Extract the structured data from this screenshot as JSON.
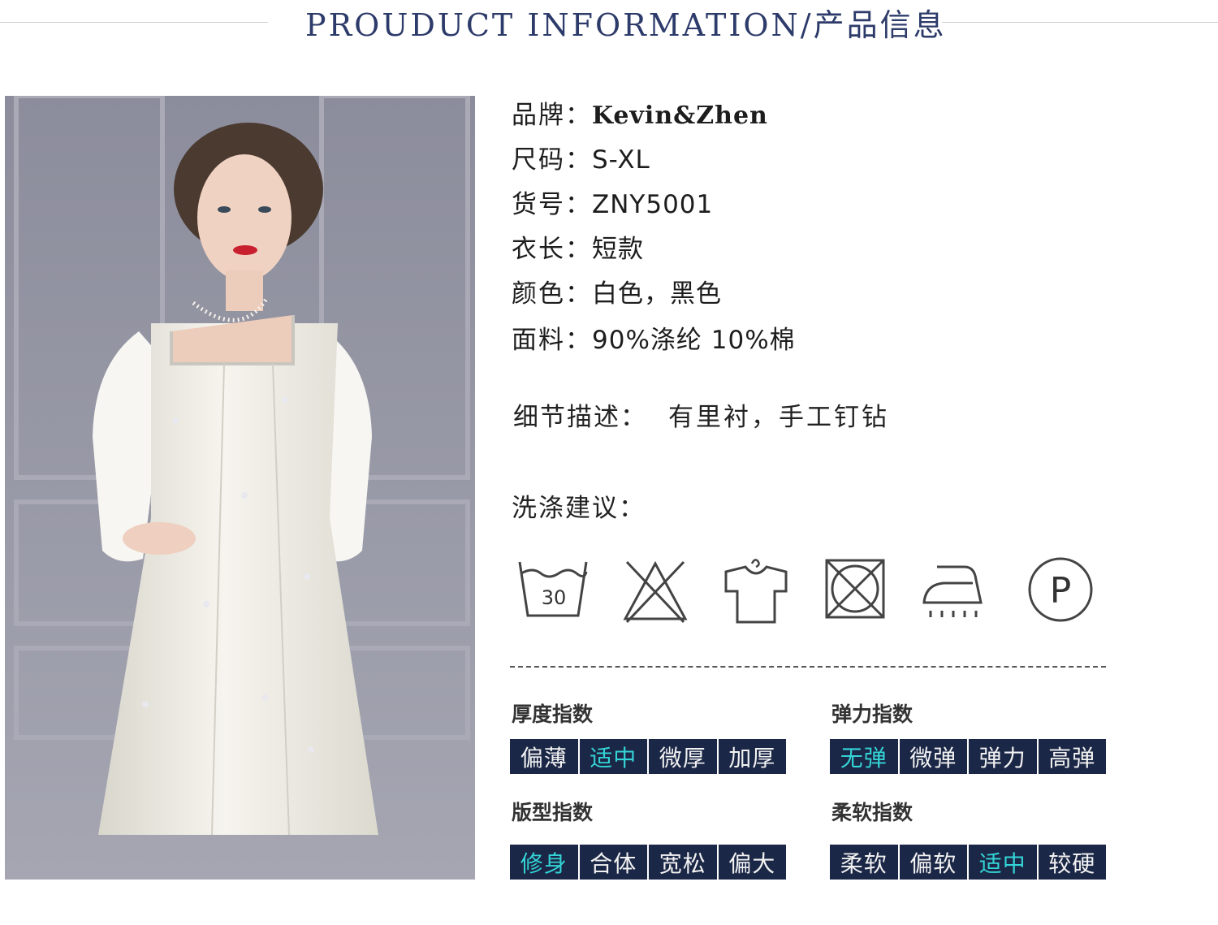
{
  "header": {
    "title": "PROUDUCT INFORMATION/产品信息"
  },
  "specs": [
    {
      "label": "品牌：",
      "value": "Kevin&Zhen"
    },
    {
      "label": "尺码：",
      "value": "S-XL"
    },
    {
      "label": "货号：",
      "value": "ZNY5001"
    },
    {
      "label": "衣长：",
      "value": "短款"
    },
    {
      "label": "颜色：",
      "value": "白色，黑色"
    },
    {
      "label": "面料：",
      "value": "90%涤纶 10%棉"
    }
  ],
  "detail": {
    "label": "细节描述：",
    "value": "有里衬，手工钉钻"
  },
  "wash": {
    "title": "洗涤建议：",
    "icons": [
      "wash-30-icon",
      "do-not-bleach-icon",
      "hang-dry-icon",
      "do-not-tumble-dry-icon",
      "iron-steam-icon",
      "dry-clean-p-icon"
    ],
    "wash_temp": "30",
    "dryclean_letter": "P"
  },
  "indices": {
    "thickness": {
      "title": "厚度指数",
      "options": [
        "偏薄",
        "适中",
        "微厚",
        "加厚"
      ],
      "selected": "适中"
    },
    "elasticity": {
      "title": "弹力指数",
      "options": [
        "无弹",
        "微弹",
        "弹力",
        "高弹"
      ],
      "selected": "无弹"
    },
    "fit": {
      "title": "版型指数",
      "options": [
        "修身",
        "合体",
        "宽松",
        "偏大"
      ],
      "selected": "修身"
    },
    "softness": {
      "title": "柔软指数",
      "options": [
        "柔软",
        "偏软",
        "适中",
        "较硬"
      ],
      "selected": "适中"
    }
  },
  "colors": {
    "header_text": "#2d3b6a",
    "scale_bg": "#1b2746",
    "scale_text": "#f2f2f2",
    "scale_selected": "#34d4d6"
  }
}
